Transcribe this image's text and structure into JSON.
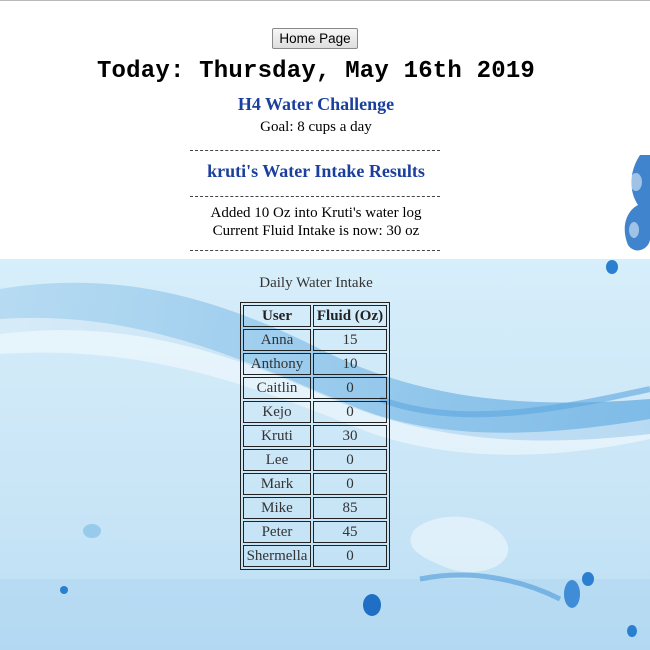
{
  "page": {
    "home_button": "Home Page",
    "today": "Today: Thursday, May 16th 2019",
    "challenge_title": "H4 Water Challenge",
    "goal": "Goal: 8 cups a day",
    "divider": "------------------------------------------------------",
    "results_title": "kruti's Water Intake Results",
    "added_msg": "Added 10 Oz into Kruti's water log",
    "current_msg": "Current Fluid Intake is now: 30 oz"
  },
  "table": {
    "caption": "Daily Water Intake",
    "headers": [
      "User",
      "Fluid (Oz)"
    ],
    "rows": [
      [
        "Anna",
        "15"
      ],
      [
        "Anthony",
        "10"
      ],
      [
        "Caitlin",
        "0"
      ],
      [
        "Kejo",
        "0"
      ],
      [
        "Kruti",
        "30"
      ],
      [
        "Lee",
        "0"
      ],
      [
        "Mark",
        "0"
      ],
      [
        "Mike",
        "85"
      ],
      [
        "Peter",
        "45"
      ],
      [
        "Shermella",
        "0"
      ]
    ]
  },
  "colors": {
    "heading_blue": "#1a3f9c",
    "water_light": "#d7eefb",
    "water_dark": "#1f6fc4"
  }
}
